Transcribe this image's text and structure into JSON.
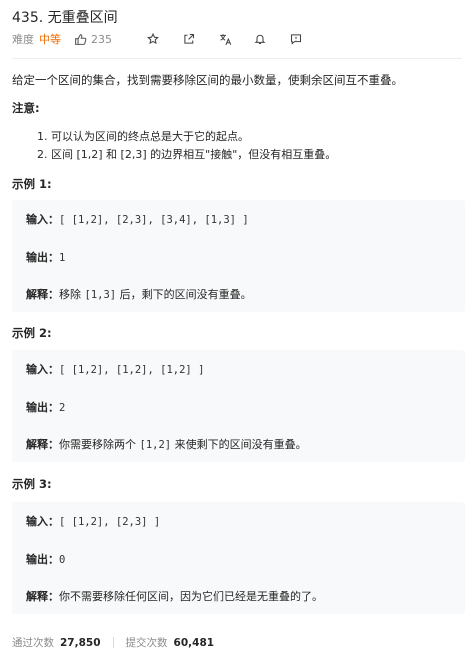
{
  "problem": {
    "title": "435. 无重叠区间",
    "difficulty_label": "难度",
    "difficulty_value": "中等",
    "likes": "235",
    "icons": [
      "thumbs-up-icon",
      "star-icon",
      "share-icon",
      "translate-icon",
      "bell-icon",
      "feedback-icon"
    ],
    "accent_color": "#ef6c00"
  },
  "description": "给定一个区间的集合，找到需要移除区间的最小数量，使剩余区间互不重叠。",
  "note": {
    "title": "注意:",
    "items": [
      "1. 可以认为区间的终点总是大于它的起点。",
      "2. 区间 [1,2] 和 [2,3] 的边界相互\"接触\"，但没有相互重叠。"
    ]
  },
  "labels": {
    "input": "输入：",
    "output": "输出：",
    "explain": "解释："
  },
  "examples": [
    {
      "title": "示例 1:",
      "input": "[ [1,2], [2,3], [3,4], [1,3] ]",
      "output": "1",
      "explain_pre": "移除",
      "explain_code": "[1,3]",
      "explain_post": "后，剩下的区间没有重叠。"
    },
    {
      "title": "示例 2:",
      "input": "[ [1,2], [1,2], [1,2] ]",
      "output": "2",
      "explain_pre": "你需要移除两个",
      "explain_code": "[1,2]",
      "explain_post": "来使剩下的区间没有重叠。"
    },
    {
      "title": "示例 3:",
      "input": "[ [1,2], [2,3] ]",
      "output": "0",
      "explain_pre": "你不需要移除任何区间，因为它们已经是无重叠的了。",
      "explain_code": "",
      "explain_post": ""
    }
  ],
  "stats": {
    "accepted_label": "通过次数",
    "accepted_value": "27,850",
    "submissions_label": "提交次数",
    "submissions_value": "60,481"
  }
}
